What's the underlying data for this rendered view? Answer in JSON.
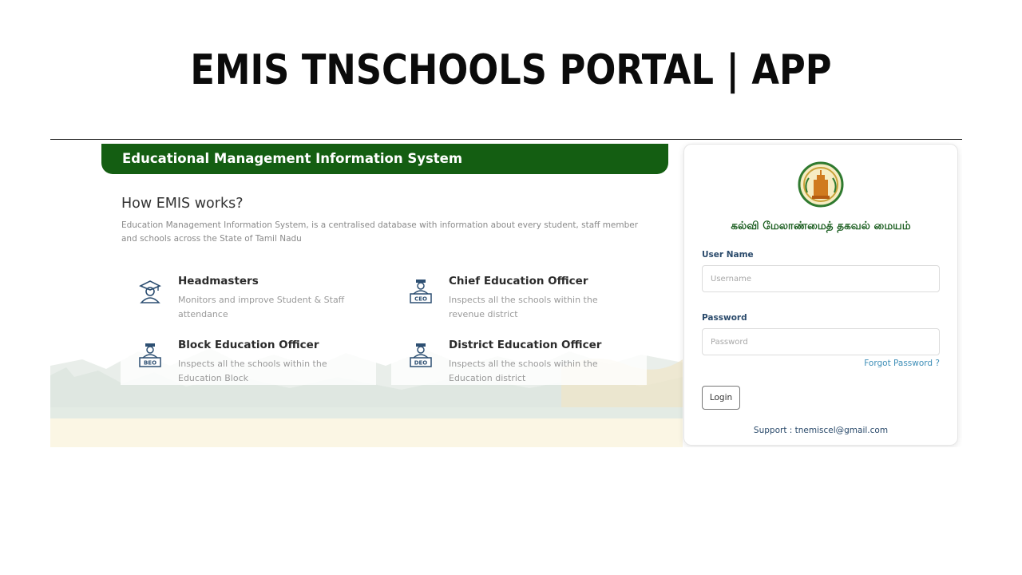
{
  "page": {
    "title": "EMIS TNSCHOOLS PORTAL | APP"
  },
  "portal": {
    "banner": "Educational Management Information System",
    "how_title": "How EMIS works?",
    "how_description": "Education Management Information System, is a centralised database with information about every student, staff member and schools across the State of Tamil Nadu",
    "roles": [
      {
        "name": "Headmasters",
        "description": "Monitors and improve Student & Staff attendance",
        "icon": "headmaster-icon"
      },
      {
        "name": "Chief Education Officer",
        "description": "Inspects all the schools within the revenue district",
        "icon": "ceo-officer-icon",
        "badge": "CEO"
      },
      {
        "name": "Block Education Officer",
        "description": "Inspects all the schools within the Education Block",
        "icon": "beo-officer-icon",
        "badge": "BEO"
      },
      {
        "name": "District Education Officer",
        "description": "Inspects all the schools within the Education district",
        "icon": "deo-officer-icon",
        "badge": "DEO"
      }
    ]
  },
  "login": {
    "department_name": "கல்வி மேலாண்மைத் தகவல் மையம்",
    "username_label": "User Name",
    "username_placeholder": "Username",
    "password_label": "Password",
    "password_placeholder": "Password",
    "forgot_label": "Forgot Password ?",
    "login_button": "Login",
    "support_text": "Support : tnemiscel@gmail.com"
  },
  "colors": {
    "brand_green": "#145e12",
    "link_blue": "#3f8fb8",
    "label_navy": "#2a4a6b"
  }
}
